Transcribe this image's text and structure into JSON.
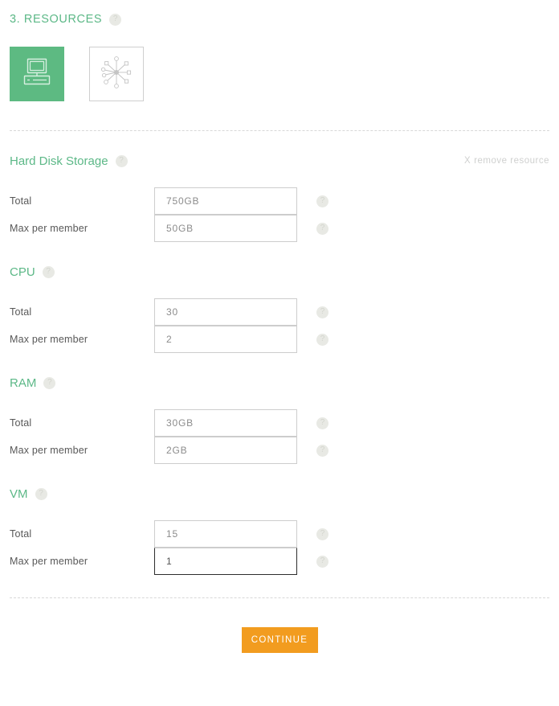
{
  "section": {
    "title": "3. RESOURCES",
    "help_icon": "help-icon",
    "help_label": "?"
  },
  "resource_types": [
    {
      "name": "computer",
      "icon": "desktop-computer-icon",
      "selected": true
    },
    {
      "name": "network",
      "icon": "network-hub-icon",
      "selected": false
    }
  ],
  "remove_resource": {
    "x": "X",
    "label": "remove resource"
  },
  "labels": {
    "total": "Total",
    "max_per_member": "Max per member"
  },
  "groups": [
    {
      "title": "Hard Disk Storage",
      "show_remove": true,
      "total": "750GB",
      "max_per_member": "50GB",
      "focused": ""
    },
    {
      "title": "CPU",
      "show_remove": false,
      "total": "30",
      "max_per_member": "2",
      "focused": ""
    },
    {
      "title": "RAM",
      "show_remove": false,
      "total": "30GB",
      "max_per_member": "2GB",
      "focused": ""
    },
    {
      "title": "VM",
      "show_remove": false,
      "total": "15",
      "max_per_member": "1",
      "focused": "max_per_member"
    }
  ],
  "footer": {
    "continue_label": "CONTINUE"
  },
  "colors": {
    "accent_green": "#5cb887",
    "tile_green": "#5dba82",
    "button_orange": "#f29c1f",
    "text_gray": "#585858",
    "muted_gray": "#cfd0cf",
    "border_gray": "#cdcdcd"
  }
}
